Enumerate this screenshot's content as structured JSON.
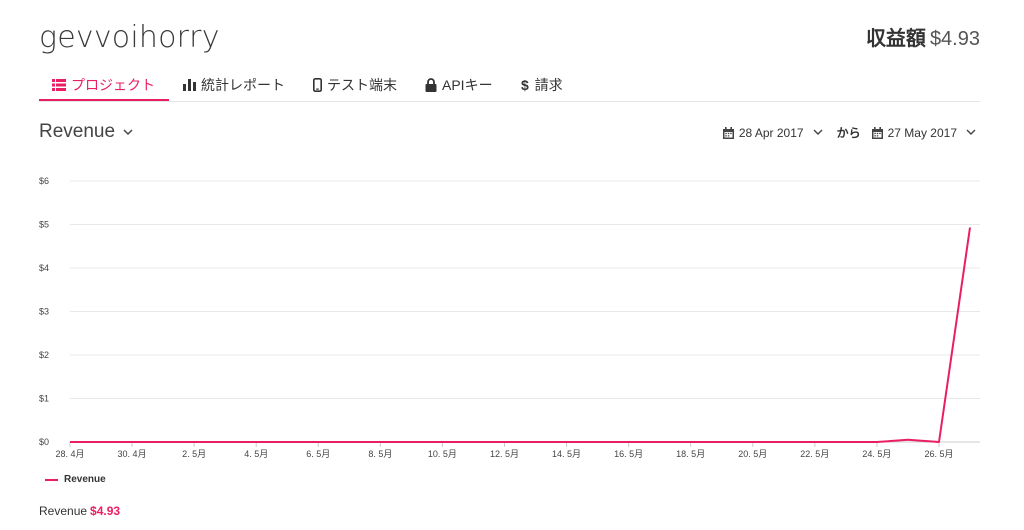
{
  "app": {
    "title": "gevvoihorry",
    "earnings_label": "収益額",
    "earnings_value": "$4.93"
  },
  "tabs": [
    {
      "label": "プロジェクト",
      "icon": "list-icon",
      "active": true
    },
    {
      "label": "統計レポート",
      "icon": "bar-chart-icon",
      "active": false
    },
    {
      "label": "テスト端末",
      "icon": "mobile-icon",
      "active": false
    },
    {
      "label": "APIキー",
      "icon": "lock-icon",
      "active": false
    },
    {
      "label": "請求",
      "icon": "dollar-icon",
      "active": false
    }
  ],
  "section": {
    "title": "Revenue"
  },
  "date_range": {
    "from": "28 Apr 2017",
    "connector": "から",
    "to": "27 May 2017"
  },
  "colors": {
    "accent": "#e91e63"
  },
  "chart_data": {
    "type": "line",
    "x_tick_labels": [
      "28. 4月",
      "30. 4月",
      "2. 5月",
      "4. 5月",
      "6. 5月",
      "8. 5月",
      "10. 5月",
      "12. 5月",
      "14. 5月",
      "16. 5月",
      "18. 5月",
      "20. 5月",
      "22. 5月",
      "24. 5月",
      "26. 5月"
    ],
    "y_tick_labels": [
      "$0",
      "$1",
      "$2",
      "$3",
      "$4",
      "$5",
      "$6"
    ],
    "ylim": [
      0,
      6
    ],
    "grid": true,
    "legend_position": "bottom-left",
    "series": [
      {
        "name": "Revenue",
        "color": "#e91e63",
        "x": [
          "28 Apr",
          "29 Apr",
          "30 Apr",
          "1 May",
          "2 May",
          "3 May",
          "4 May",
          "5 May",
          "6 May",
          "7 May",
          "8 May",
          "9 May",
          "10 May",
          "11 May",
          "12 May",
          "13 May",
          "14 May",
          "15 May",
          "16 May",
          "17 May",
          "18 May",
          "19 May",
          "20 May",
          "21 May",
          "22 May",
          "23 May",
          "24 May",
          "25 May",
          "26 May",
          "27 May"
        ],
        "values": [
          0,
          0,
          0,
          0,
          0,
          0,
          0,
          0,
          0,
          0,
          0,
          0,
          0,
          0,
          0,
          0,
          0,
          0,
          0,
          0,
          0,
          0,
          0,
          0,
          0,
          0,
          0,
          0.05,
          0,
          4.93
        ]
      }
    ]
  },
  "summary": {
    "label": "Revenue",
    "value": "$4.93"
  }
}
